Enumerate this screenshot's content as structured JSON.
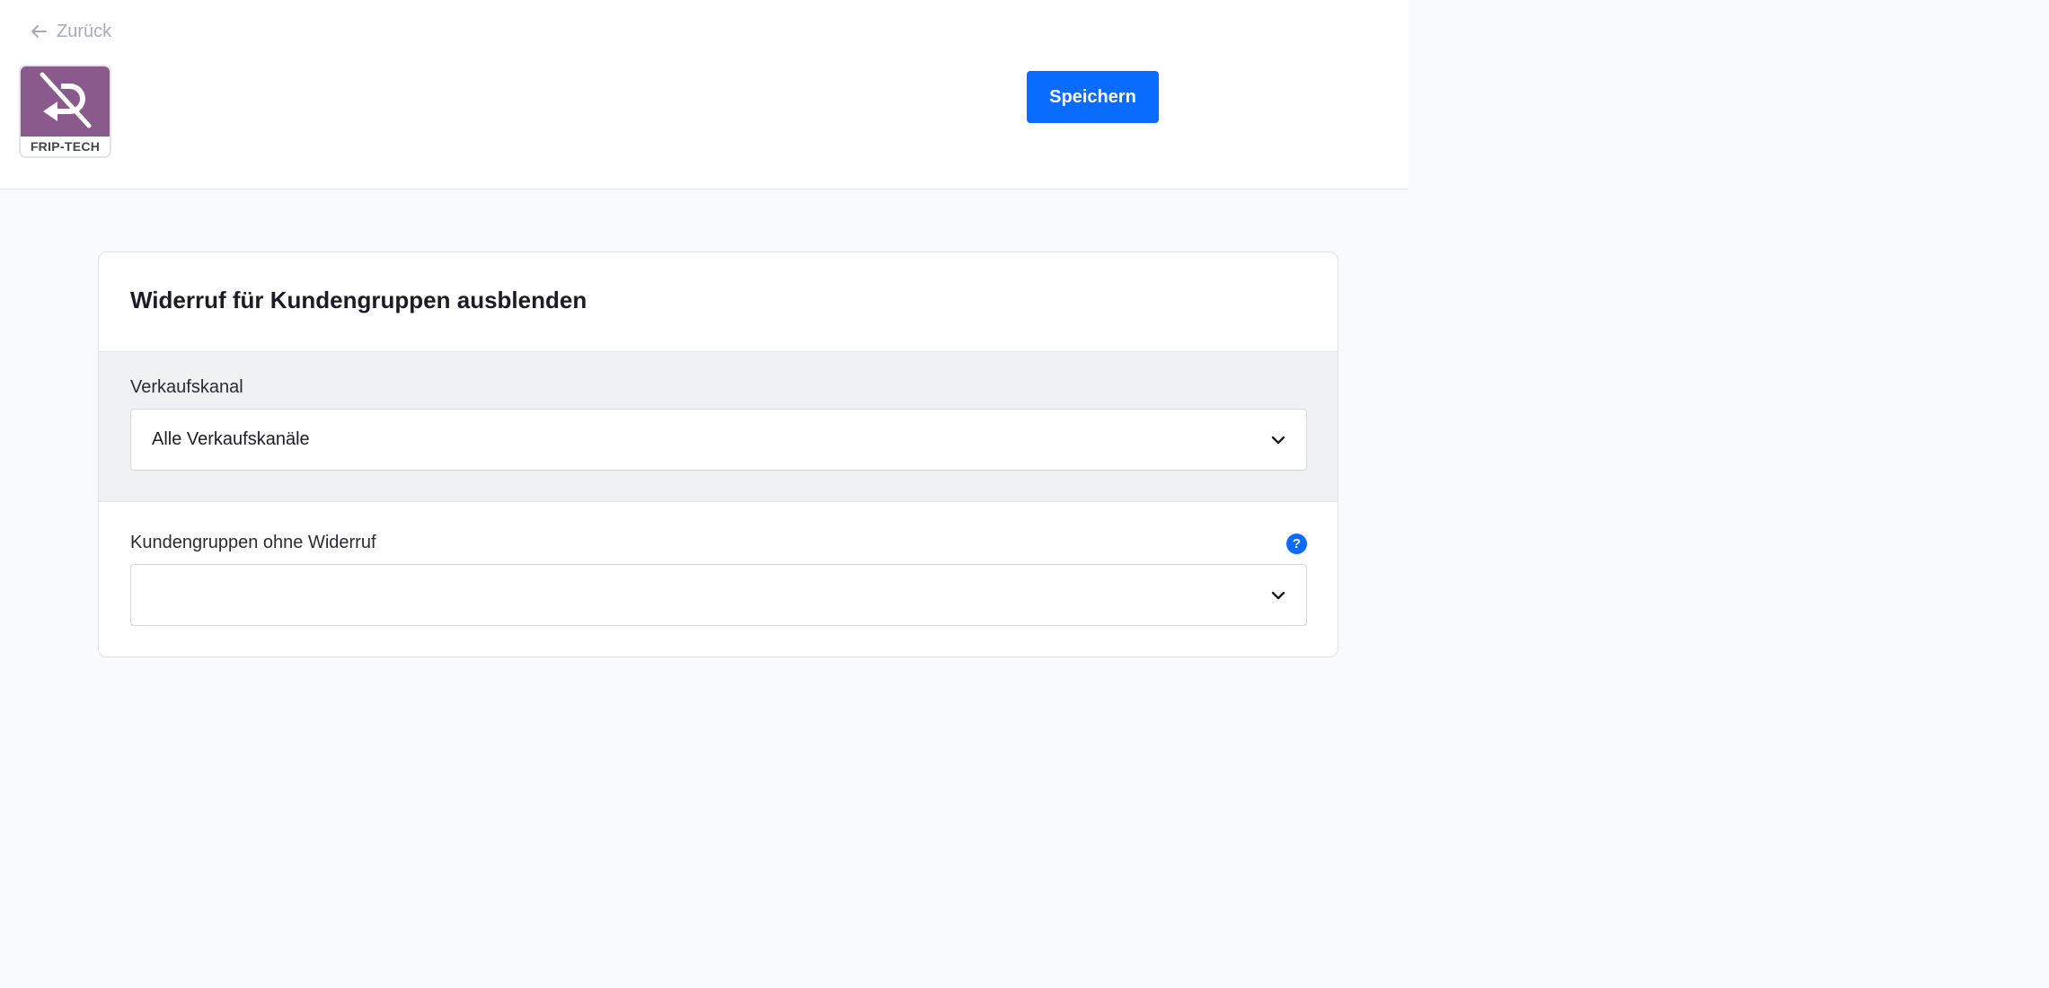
{
  "header": {
    "back_label": "Zurück",
    "logo_text": "FRIP-TECH",
    "save_label": "Speichern"
  },
  "card": {
    "title": "Widerruf für Kundengruppen ausblenden",
    "sales_channel": {
      "label": "Verkaufskanal",
      "selected": "Alle Verkaufskanäle"
    },
    "customer_groups": {
      "label": "Kundengruppen ohne Widerruf",
      "selected": "",
      "help_glyph": "?"
    }
  },
  "icons": {
    "back": "arrow-left-icon",
    "chevron": "chevron-down-icon",
    "help": "question-circle-icon"
  },
  "colors": {
    "accent": "#0a6cff",
    "logo_background": "#8a5a8c"
  }
}
